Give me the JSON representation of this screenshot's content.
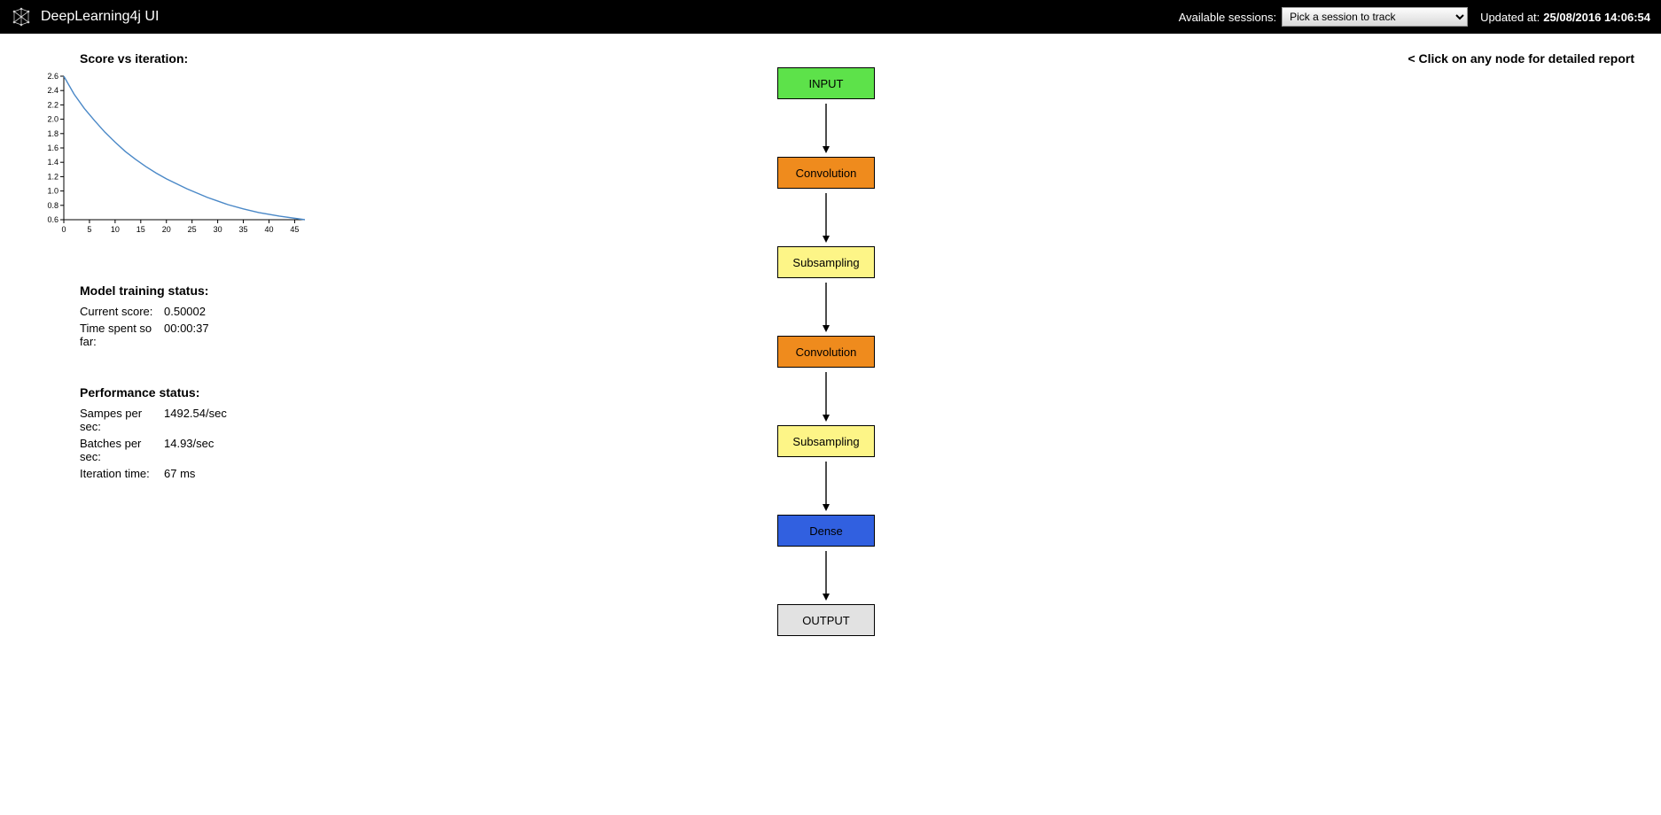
{
  "header": {
    "title": "DeepLearning4j UI",
    "sessions_label": "Available sessions:",
    "session_selected": "Pick a session to track",
    "updated_label": "Updated at:",
    "updated_time": "25/08/2016 14:06:54"
  },
  "chart_title": "Score vs iteration:",
  "chart_data": {
    "type": "line",
    "title": "Score vs iteration",
    "xlabel": "",
    "ylabel": "",
    "xlim": [
      0,
      47
    ],
    "ylim": [
      0.6,
      2.6
    ],
    "x_ticks": [
      0,
      5,
      10,
      15,
      20,
      25,
      30,
      35,
      40,
      45
    ],
    "y_ticks": [
      0.6,
      0.8,
      1.0,
      1.2,
      1.4,
      1.6,
      1.8,
      2.0,
      2.2,
      2.4,
      2.6
    ],
    "series": [
      {
        "name": "score",
        "x": [
          0,
          2,
          4,
          6,
          8,
          10,
          12,
          14,
          16,
          18,
          20,
          22,
          24,
          26,
          28,
          30,
          32,
          35,
          38,
          42,
          47
        ],
        "y": [
          2.6,
          2.35,
          2.15,
          1.98,
          1.82,
          1.68,
          1.55,
          1.44,
          1.34,
          1.25,
          1.17,
          1.1,
          1.03,
          0.97,
          0.91,
          0.86,
          0.81,
          0.75,
          0.7,
          0.65,
          0.6
        ]
      }
    ]
  },
  "training_status": {
    "heading": "Model training status:",
    "rows": [
      {
        "label": "Current score:",
        "value": "0.50002"
      },
      {
        "label": "Time spent so far:",
        "value": "00:00:37"
      }
    ]
  },
  "performance_status": {
    "heading": "Performance status:",
    "rows": [
      {
        "label": "Sampes per sec:",
        "value": "1492.54/sec"
      },
      {
        "label": "Batches per sec:",
        "value": "14.93/sec"
      },
      {
        "label": "Iteration time:",
        "value": "67 ms"
      }
    ]
  },
  "nodes": [
    {
      "id": "input",
      "label": "INPUT",
      "cls": "input"
    },
    {
      "id": "conv1",
      "label": "Convolution",
      "cls": "conv"
    },
    {
      "id": "sub1",
      "label": "Subsampling",
      "cls": "subsamp"
    },
    {
      "id": "conv2",
      "label": "Convolution",
      "cls": "conv"
    },
    {
      "id": "sub2",
      "label": "Subsampling",
      "cls": "subsamp"
    },
    {
      "id": "dense",
      "label": "Dense",
      "cls": "dense"
    },
    {
      "id": "output",
      "label": "OUTPUT",
      "cls": "output"
    }
  ],
  "hint": "< Click on any node for detailed report"
}
